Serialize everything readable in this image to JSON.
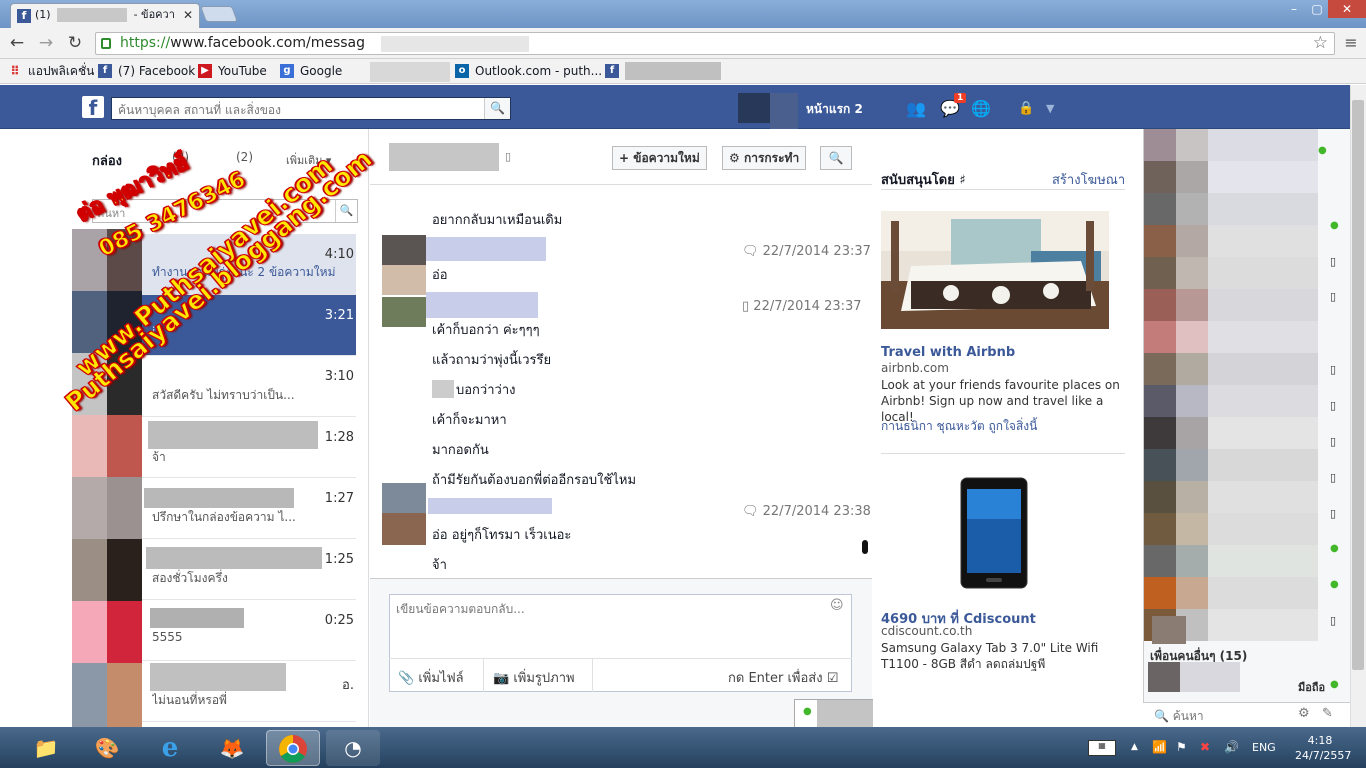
{
  "browser": {
    "tabs": [
      {
        "label": "(1)",
        "suffix": "- ข้อควา"
      }
    ],
    "url": {
      "scheme": "https://",
      "rest": "www.facebook.com/messag"
    },
    "bookmarks": [
      "แอปพลิเคชั่น",
      "(7) Facebook",
      "YouTube",
      "Google",
      "Outlook.com - puth..."
    ],
    "window_controls": [
      "–",
      "▢",
      "✕"
    ]
  },
  "fb_header": {
    "logo": "f",
    "search_placeholder": "ค้นหาบุคคล สถานที่ และสิ่งของ",
    "home_label": "หน้าแรก 2",
    "notification_count": "1"
  },
  "inbox": {
    "title": "กล่อง",
    "filter_counts": "(2)",
    "filter_other": "(2)",
    "more_label": "เพิ่มเติม",
    "search_placeholder": "ค้นหา",
    "conversations": [
      {
        "time": "4:10",
        "snippet": "ทำงานตอนพรุ่งนนะ 2 ข้อความใหม่"
      },
      {
        "time": "3:21",
        "snippet": "i..."
      },
      {
        "time": "3:10",
        "snippet": "สวัสดีครับ ไม่ทราบว่าเป็น..."
      },
      {
        "time": "1:28",
        "snippet": "จ้า"
      },
      {
        "time": "1:27",
        "snippet": "ปรึกษาในกล่องข้อความ ไ..."
      },
      {
        "time": "1:25",
        "snippet": "สองชั่วโมงครึ่ง"
      },
      {
        "time": "0:25",
        "snippet": "5555"
      },
      {
        "time": "อ.",
        "snippet": "ไม่นอนที่หรอพี่"
      }
    ]
  },
  "conversation": {
    "new_message_label": "ข้อความใหม่",
    "actions_label": "การกระทำ",
    "messages": [
      {
        "text": "อยากกลับมาเหมือนเดิม"
      },
      {
        "text": "อ่อ",
        "timestamp": "22/7/2014 23:37"
      },
      {
        "text": "เค้าก็บอกว่า ค่ะๆๆๆ",
        "timestamp": "22/7/2014 23:37"
      },
      {
        "text": "แล้วถามว่าพุ่งนี้เวรรึย"
      },
      {
        "text": "บอกว่าว่าง"
      },
      {
        "text": "เค้าก็จะมาหา"
      },
      {
        "text": "มากอดกัน"
      },
      {
        "text": "ถ้ามีรัยกันต้องบอกพี่ต่ออีกรอบใช้ไหม"
      },
      {
        "text": "อ่อ อยู่ๆก็โทรมา เร็วเนอะ",
        "timestamp": "22/7/2014 23:38"
      },
      {
        "text": "จ้า"
      }
    ],
    "reply_placeholder": "เขียนข้อความตอบกลับ...",
    "add_file_label": "เพิ่มไฟล์",
    "add_photo_label": "เพิ่มรูปภาพ",
    "enter_to_send_label": "กด Enter เพื่อส่ง"
  },
  "ads": {
    "sponsored_label": "สนับสนุนโดย",
    "create_ad_label": "สร้างโฆษณา",
    "items": [
      {
        "title": "Travel with Airbnb",
        "domain": "airbnb.com",
        "body": "Look at your friends favourite places on Airbnb! Sign up now and travel like a local!",
        "social": "กานธนิกา ชุณหะวัต ถูกใจสิ่งนี้"
      },
      {
        "title": "4690 บาท ที่ Cdiscount",
        "domain": "cdiscount.co.th",
        "body": "Samsung Galaxy Tab 3 7.0\" Lite Wifi T1100 - 8GB สีดำ ลดถล่มปฐพี"
      }
    ]
  },
  "chat_sidebar": {
    "more_friends_label": "เพื่อนคนอื่นๆ (15)",
    "mobile_label": "มือถือ",
    "search_placeholder": "ค้นหา"
  },
  "watermark": {
    "line1": "ต่อ พุฒาวิทย์",
    "line2": "085 3476346",
    "line3": "www.Puthsaiyavei.com",
    "line4": "Puthsaiyavei.bloggang.com"
  },
  "taskbar": {
    "lang": "ENG",
    "time": "4:18",
    "date": "24/7/2557"
  },
  "colors": {
    "facebook_blue": "#3b5998",
    "watermark_fill": "#ffe800",
    "watermark_stroke": "#d00000"
  }
}
